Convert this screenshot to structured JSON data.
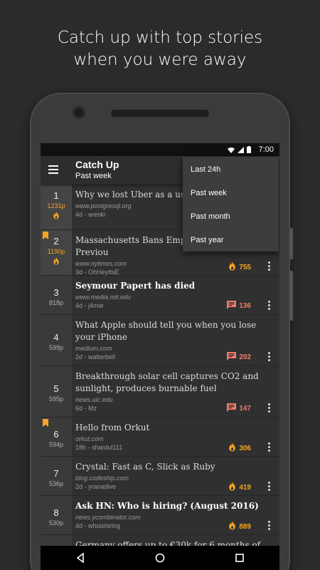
{
  "promo": {
    "line1": "Catch up with top stories",
    "line2": "when you were away"
  },
  "status_bar": {
    "time": "7:00",
    "icons": [
      "wifi-icon",
      "signal-icon",
      "battery-icon"
    ]
  },
  "toolbar": {
    "title": "Catch Up",
    "subtitle": "Past week",
    "menu_icon": "hamburger-menu-icon"
  },
  "dropdown": {
    "options": [
      "Last 24h",
      "Past week",
      "Past month",
      "Past year"
    ]
  },
  "stories": [
    {
      "rank": "1",
      "points": "1231p",
      "hot": true,
      "bookmarked": false,
      "title": "Why we lost Uber as a use",
      "domain": "www.postgresql.org",
      "meta": "4d - areski",
      "stat_type": "none",
      "stat": ""
    },
    {
      "rank": "2",
      "points": "1190p",
      "hot": true,
      "bookmarked": true,
      "title": "Massachusetts Bans Emp Applicants About Previou",
      "domain": "www.nytimes.com",
      "meta": "3d - OhHeyItsE",
      "stat_type": "fire",
      "stat": "755"
    },
    {
      "rank": "3",
      "points": "818p",
      "hot": false,
      "bookmarked": false,
      "title": "Seymour Papert has died",
      "domain": "www.media.mit.edu",
      "meta": "4d - j4mie",
      "stat_type": "comment",
      "stat": "136",
      "bold": true
    },
    {
      "rank": "4",
      "points": "599p",
      "hot": false,
      "bookmarked": false,
      "title": "What Apple should tell you when you lose your iPhone",
      "domain": "medium.com",
      "meta": "2d - walterbell",
      "stat_type": "comment",
      "stat": "202"
    },
    {
      "rank": "5",
      "points": "595p",
      "hot": false,
      "bookmarked": false,
      "title": "Breakthrough solar cell captures CO2 and sunlight, produces burnable fuel",
      "domain": "news.uic.edu",
      "meta": "6d - Mz",
      "stat_type": "comment",
      "stat": "147"
    },
    {
      "rank": "6",
      "points": "594p",
      "hot": false,
      "bookmarked": true,
      "title": "Hello from Orkut",
      "domain": "orkut.com",
      "meta": "18h - shardul111",
      "stat_type": "fire",
      "stat": "306"
    },
    {
      "rank": "7",
      "points": "536p",
      "hot": false,
      "bookmarked": false,
      "title": "Crystal: Fast as C, Slick as Ruby",
      "domain": "blog.codeship.com",
      "meta": "2d - yranadive",
      "stat_type": "fire",
      "stat": "419"
    },
    {
      "rank": "8",
      "points": "530p",
      "hot": false,
      "bookmarked": false,
      "title": "Ask HN: Who is hiring? (August 2016)",
      "domain": "news.ycombinator.com",
      "meta": "4d - whoishiring",
      "stat_type": "fire",
      "stat": "889",
      "bold": true
    },
    {
      "rank": "",
      "points": "",
      "hot": false,
      "bookmarked": false,
      "title": "Germany offers up to €30k for 6 months of",
      "domain": "",
      "meta": "",
      "stat_type": "none",
      "stat": ""
    }
  ],
  "colors": {
    "accent_orange": "#f5a623",
    "comment_red": "#f27b6b",
    "background": "#2b2b2b"
  },
  "nav_bar": [
    "back-icon",
    "home-icon",
    "recents-icon"
  ]
}
